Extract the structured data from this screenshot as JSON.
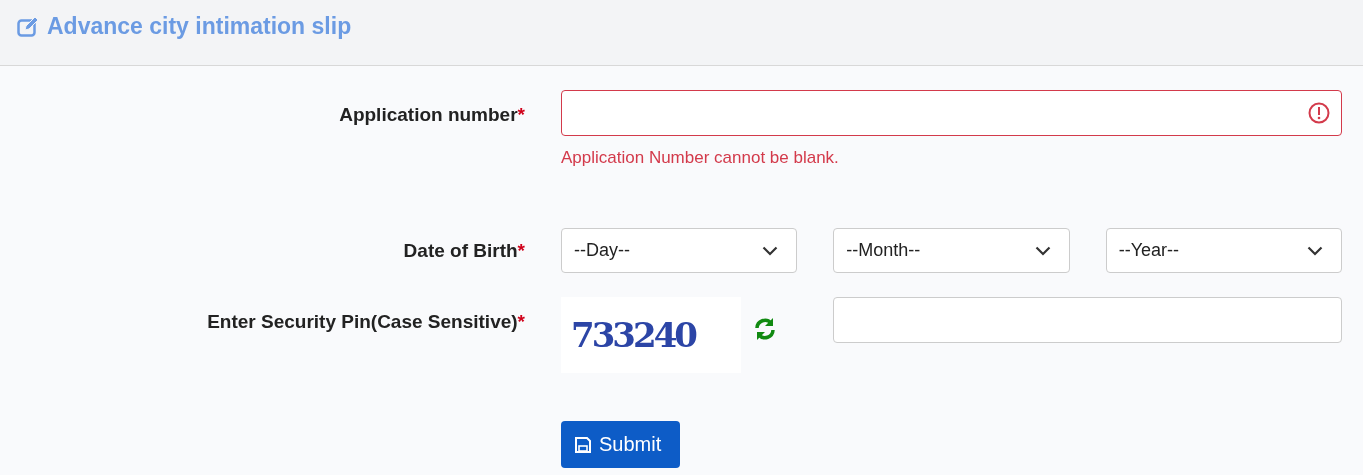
{
  "header": {
    "title": "Advance city intimation slip"
  },
  "fields": [
    {
      "kind": "text",
      "label": "Application number",
      "required_mark": "*",
      "invalid": true,
      "error": "Application Number cannot be blank."
    },
    {
      "kind": "selects",
      "label": "Date of Birth",
      "required_mark": "*",
      "selects": [
        {
          "value": "--Day--"
        },
        {
          "value": "--Month--"
        },
        {
          "value": "--Year--"
        }
      ]
    },
    {
      "kind": "captcha",
      "label": "Enter Security Pin(Case Sensitive)",
      "required_mark": "*",
      "captcha": "733240"
    }
  ],
  "submit": {
    "label": "Submit"
  }
}
